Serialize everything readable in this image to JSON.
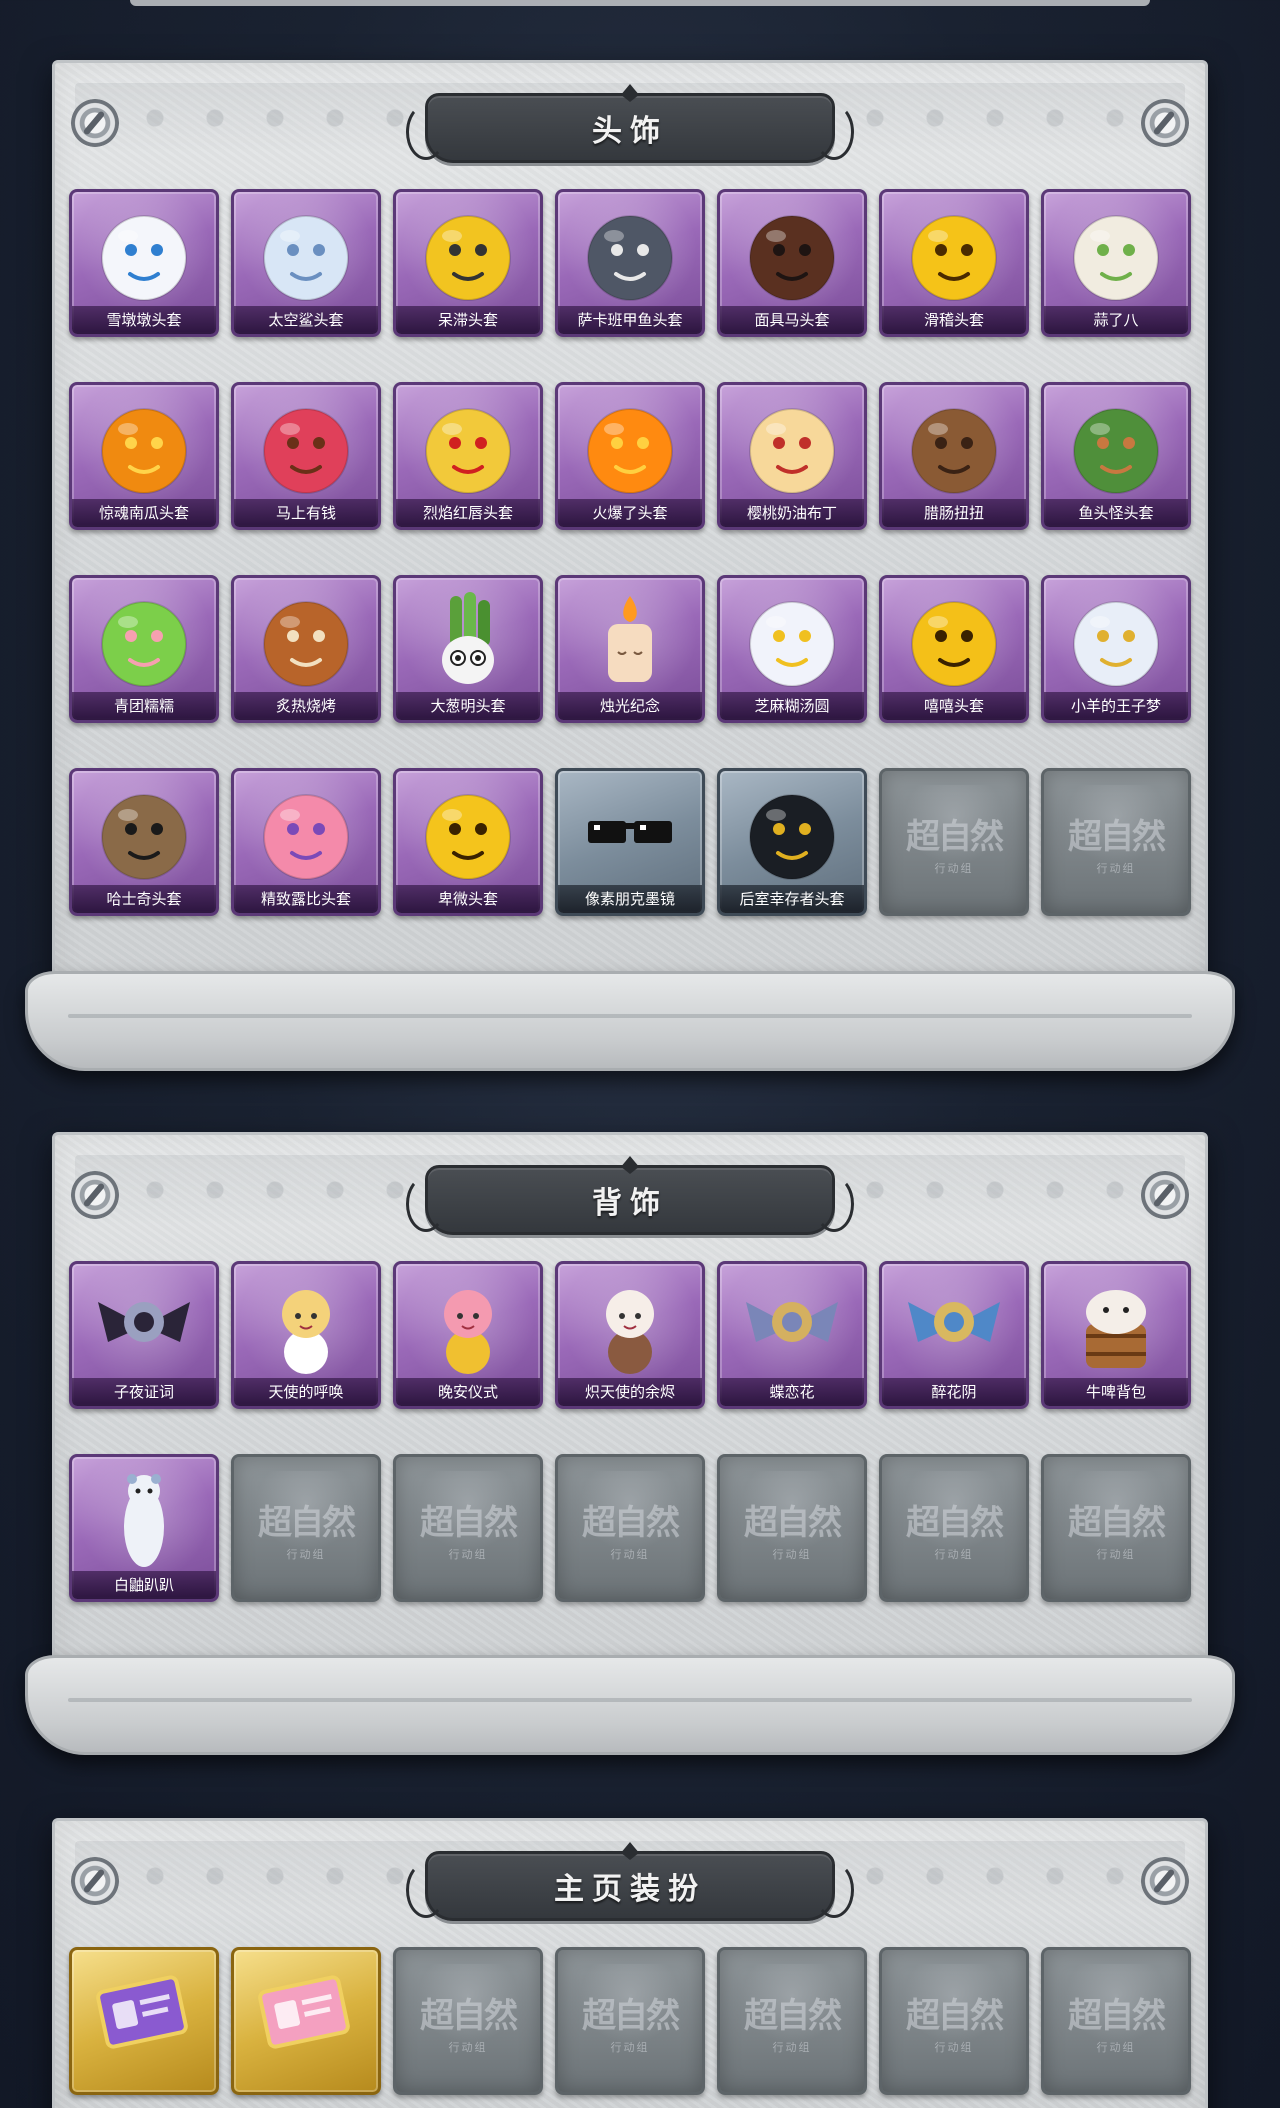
{
  "sections": [
    {
      "title": "头饰",
      "items": [
        {
          "label": "雪墩墩头套",
          "icon": "snowman-hat-icon",
          "color": "#f4f6fb",
          "accent": "#2f7fd0",
          "empty": false
        },
        {
          "label": "太空鲨头套",
          "icon": "shark-head-icon",
          "color": "#d8e6f6",
          "accent": "#6a8fc0",
          "empty": false
        },
        {
          "label": "呆滞头套",
          "icon": "dazed-face-icon",
          "color": "#f2c420",
          "accent": "#333333",
          "empty": false
        },
        {
          "label": "萨卡班甲鱼头套",
          "icon": "fish-head-icon",
          "color": "#4f5766",
          "accent": "#e8e8e8",
          "empty": false
        },
        {
          "label": "面具马头套",
          "icon": "horse-mask-icon",
          "color": "#5a3020",
          "accent": "#1e1412",
          "empty": false
        },
        {
          "label": "滑稽头套",
          "icon": "funny-face-icon",
          "color": "#f5c318",
          "accent": "#4a2b00",
          "empty": false
        },
        {
          "label": "蒜了八",
          "icon": "garlic-icon",
          "color": "#f1ece0",
          "accent": "#6fb04a",
          "empty": false
        },
        {
          "label": "惊魂南瓜头套",
          "icon": "pumpkin-icon",
          "color": "#f08a10",
          "accent": "#ffd44a",
          "empty": false
        },
        {
          "label": "马上有钱",
          "icon": "red-horse-icon",
          "color": "#e0405a",
          "accent": "#6a3018",
          "empty": false
        },
        {
          "label": "烈焰红唇头套",
          "icon": "lips-mask-icon",
          "color": "#f2c93a",
          "accent": "#d02020",
          "empty": false
        },
        {
          "label": "火爆了头套",
          "icon": "fire-head-icon",
          "color": "#ff8a10",
          "accent": "#ffd040",
          "empty": false
        },
        {
          "label": "樱桃奶油布丁",
          "icon": "pudding-icon",
          "color": "#f7d89a",
          "accent": "#c0302a",
          "empty": false
        },
        {
          "label": "腊肠扭扭",
          "icon": "sausage-dog-icon",
          "color": "#8a5a34",
          "accent": "#3a2214",
          "empty": false
        },
        {
          "label": "鱼头怪头套",
          "icon": "fish-monster-icon",
          "color": "#4f8f3a",
          "accent": "#c87840",
          "empty": false
        },
        {
          "label": "青团糯糯",
          "icon": "green-dumpling-icon",
          "color": "#7ccf4a",
          "accent": "#f6a0b0",
          "empty": false
        },
        {
          "label": "炙热烧烤",
          "icon": "bbq-icon",
          "color": "#b8642a",
          "accent": "#f2e0c0",
          "empty": false
        },
        {
          "label": "大葱明头套",
          "icon": "scallion-icon",
          "color": "#8ad06a",
          "accent": "#f4f4f4",
          "empty": false
        },
        {
          "label": "烛光纪念",
          "icon": "candle-icon",
          "color": "#f6dcc0",
          "accent": "#ff9a20",
          "empty": false
        },
        {
          "label": "芝麻糊汤圆",
          "icon": "rice-ball-icon",
          "color": "#f1f3fb",
          "accent": "#f0c020",
          "empty": false
        },
        {
          "label": "嘻嘻头套",
          "icon": "grin-face-icon",
          "color": "#f4c018",
          "accent": "#3a2200",
          "empty": false
        },
        {
          "label": "小羊的王子梦",
          "icon": "sheep-prince-icon",
          "color": "#e8eef8",
          "accent": "#e0b030",
          "empty": false
        },
        {
          "label": "哈士奇头套",
          "icon": "husky-icon",
          "color": "#8a6a48",
          "accent": "#1a1a1a",
          "empty": false
        },
        {
          "label": "精致露比头套",
          "icon": "pink-beaver-icon",
          "color": "#f48aaa",
          "accent": "#7a4ab8",
          "empty": false
        },
        {
          "label": "卑微头套",
          "icon": "humble-face-icon",
          "color": "#f4c41c",
          "accent": "#3a2200",
          "empty": false
        },
        {
          "label": "像素朋克墨镜",
          "icon": "pixel-glasses-icon",
          "color": "#111111",
          "accent": "#ffffff",
          "empty": false,
          "rarity": "blue"
        },
        {
          "label": "后室幸存者头套",
          "icon": "gas-mask-icon",
          "color": "#1a1e24",
          "accent": "#e0b020",
          "empty": false,
          "rarity": "blue"
        },
        {
          "label": "",
          "icon": "",
          "empty": true
        },
        {
          "label": "",
          "icon": "",
          "empty": true
        }
      ]
    },
    {
      "title": "背饰",
      "items": [
        {
          "label": "子夜证词",
          "icon": "owl-wings-icon",
          "color": "#2a2438",
          "accent": "#9aa0c0",
          "empty": false
        },
        {
          "label": "天使的呼唤",
          "icon": "angel-icon",
          "color": "#f4d27a",
          "accent": "#ffffff",
          "empty": false
        },
        {
          "label": "晚安仪式",
          "icon": "pink-doll-icon",
          "color": "#f49ab0",
          "accent": "#f0c030",
          "empty": false
        },
        {
          "label": "炽天使的余烬",
          "icon": "seraph-doll-icon",
          "color": "#f6eee8",
          "accent": "#8a5a40",
          "empty": false
        },
        {
          "label": "蝶恋花",
          "icon": "butterfly-ornament-icon",
          "color": "#7a86b8",
          "accent": "#d4b060",
          "empty": false
        },
        {
          "label": "醉花阴",
          "icon": "flower-wreath-icon",
          "color": "#4f88c8",
          "accent": "#d8b860",
          "empty": false
        },
        {
          "label": "牛啤背包",
          "icon": "beer-cow-icon",
          "color": "#a86a34",
          "accent": "#f4eee8",
          "empty": false
        },
        {
          "label": "白鼬趴趴",
          "icon": "ermine-icon",
          "color": "#eef2f8",
          "accent": "#9ab0d0",
          "empty": false
        },
        {
          "label": "",
          "icon": "",
          "empty": true
        },
        {
          "label": "",
          "icon": "",
          "empty": true
        },
        {
          "label": "",
          "icon": "",
          "empty": true
        },
        {
          "label": "",
          "icon": "",
          "empty": true
        },
        {
          "label": "",
          "icon": "",
          "empty": true
        },
        {
          "label": "",
          "icon": "",
          "empty": true
        }
      ]
    },
    {
      "title": "主页装扮",
      "items": [
        {
          "label": "",
          "icon": "purple-id-card-icon",
          "color": "#8a5ad0",
          "accent": "#f0d060",
          "empty": false,
          "rarity": "gold"
        },
        {
          "label": "",
          "icon": "pink-id-card-icon",
          "color": "#f4a0c0",
          "accent": "#f0d060",
          "empty": false,
          "rarity": "gold"
        },
        {
          "label": "",
          "icon": "",
          "empty": true
        },
        {
          "label": "",
          "icon": "",
          "empty": true
        },
        {
          "label": "",
          "icon": "",
          "empty": true
        },
        {
          "label": "",
          "icon": "",
          "empty": true
        },
        {
          "label": "",
          "icon": "",
          "empty": true
        }
      ]
    }
  ],
  "placeholder": {
    "watermark": "超自然",
    "subtitle": "行动组"
  },
  "theme": {
    "card_purple": "#9a69b8",
    "card_blue": "#7c8d9c",
    "card_gold": "#d9b23f",
    "panel": "#d9dcde",
    "banner": "#3c4045"
  }
}
